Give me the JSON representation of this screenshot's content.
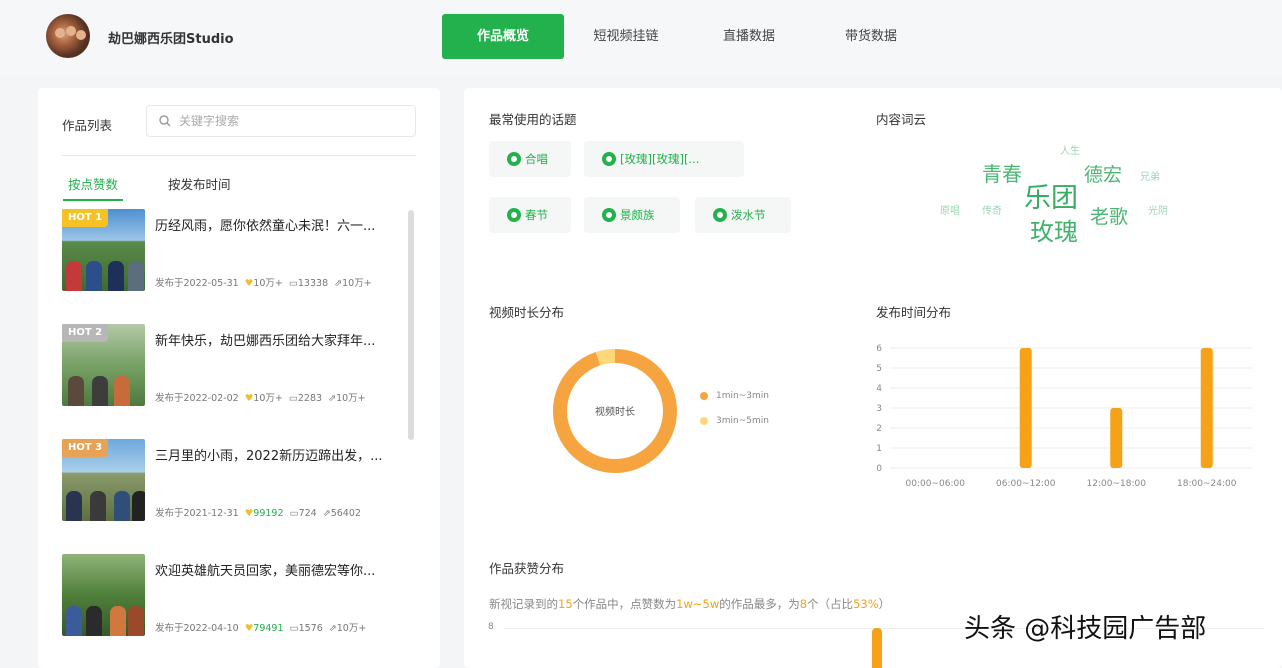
{
  "header": {
    "studio_name": "劫巴娜西乐团Studio",
    "tabs": [
      "作品概览",
      "短视频挂链",
      "直播数据",
      "带货数据"
    ],
    "active_tab": 0
  },
  "list": {
    "label": "作品列表",
    "search_placeholder": "关键字搜索",
    "sort_options": [
      "按点赞数",
      "按发布时间"
    ],
    "items": [
      {
        "hot": "HOT 1",
        "title": "历经风雨，愿你依然童心未泯！六一...",
        "date": "发布于2022-05-31",
        "likes": "10万+",
        "comments": "13338",
        "shares": "10万+"
      },
      {
        "hot": "HOT 2",
        "title": "新年快乐，劫巴娜西乐团给大家拜年...",
        "date": "发布于2022-02-02",
        "likes": "10万+",
        "comments": "2283",
        "shares": "10万+"
      },
      {
        "hot": "HOT 3",
        "title": "三月里的小雨，2022新历迈蹄出发，...",
        "date": "发布于2021-12-31",
        "likes": "99192",
        "comments": "724",
        "shares": "56402"
      },
      {
        "hot": "",
        "title": "欢迎英雄航天员回家，美丽德宏等你...",
        "date": "发布于2022-04-10",
        "likes": "79491",
        "comments": "1576",
        "shares": "10万+"
      }
    ]
  },
  "topics": {
    "label": "最常使用的话题",
    "chips": [
      "合唱",
      "[玫瑰][玫瑰][...",
      "春节",
      "景颇族",
      "泼水节"
    ]
  },
  "wordcloud": {
    "label": "内容词云",
    "words": [
      "人生",
      "青春",
      "德宏",
      "兄弟",
      "乐团",
      "原唱",
      "传奇",
      "玫瑰",
      "老歌",
      "光阴"
    ]
  },
  "duration": {
    "label": "视频时长分布",
    "center": "视频时长",
    "legend": [
      "1min~3min",
      "3min~5min"
    ]
  },
  "chart_data": [
    {
      "type": "pie",
      "categories": [
        "1min~3min",
        "3min~5min"
      ],
      "values": [
        95,
        5
      ],
      "colors": [
        "#f6a440",
        "#fdd77a"
      ]
    },
    {
      "type": "bar",
      "title": "发布时间分布",
      "categories": [
        "00:00~06:00",
        "06:00~12:00",
        "12:00~18:00",
        "18:00~24:00"
      ],
      "values": [
        0,
        6,
        3,
        6
      ],
      "yticks": [
        0,
        1,
        2,
        3,
        4,
        5,
        6
      ],
      "ylim": [
        0,
        6
      ],
      "color": "#f5a219"
    }
  ],
  "likes_dist": {
    "label": "作品获赞分布",
    "s1": "新视记录到的",
    "s_count": "15",
    "s2": "个作品中，点赞数为",
    "s_range": "1w~5w",
    "s3": "的作品最多，为",
    "s_num": "8",
    "s4": "个（占比",
    "s_pct": "53%",
    "s5": "）",
    "ytick": "8"
  },
  "watermark": "头条 @科技园广告部"
}
